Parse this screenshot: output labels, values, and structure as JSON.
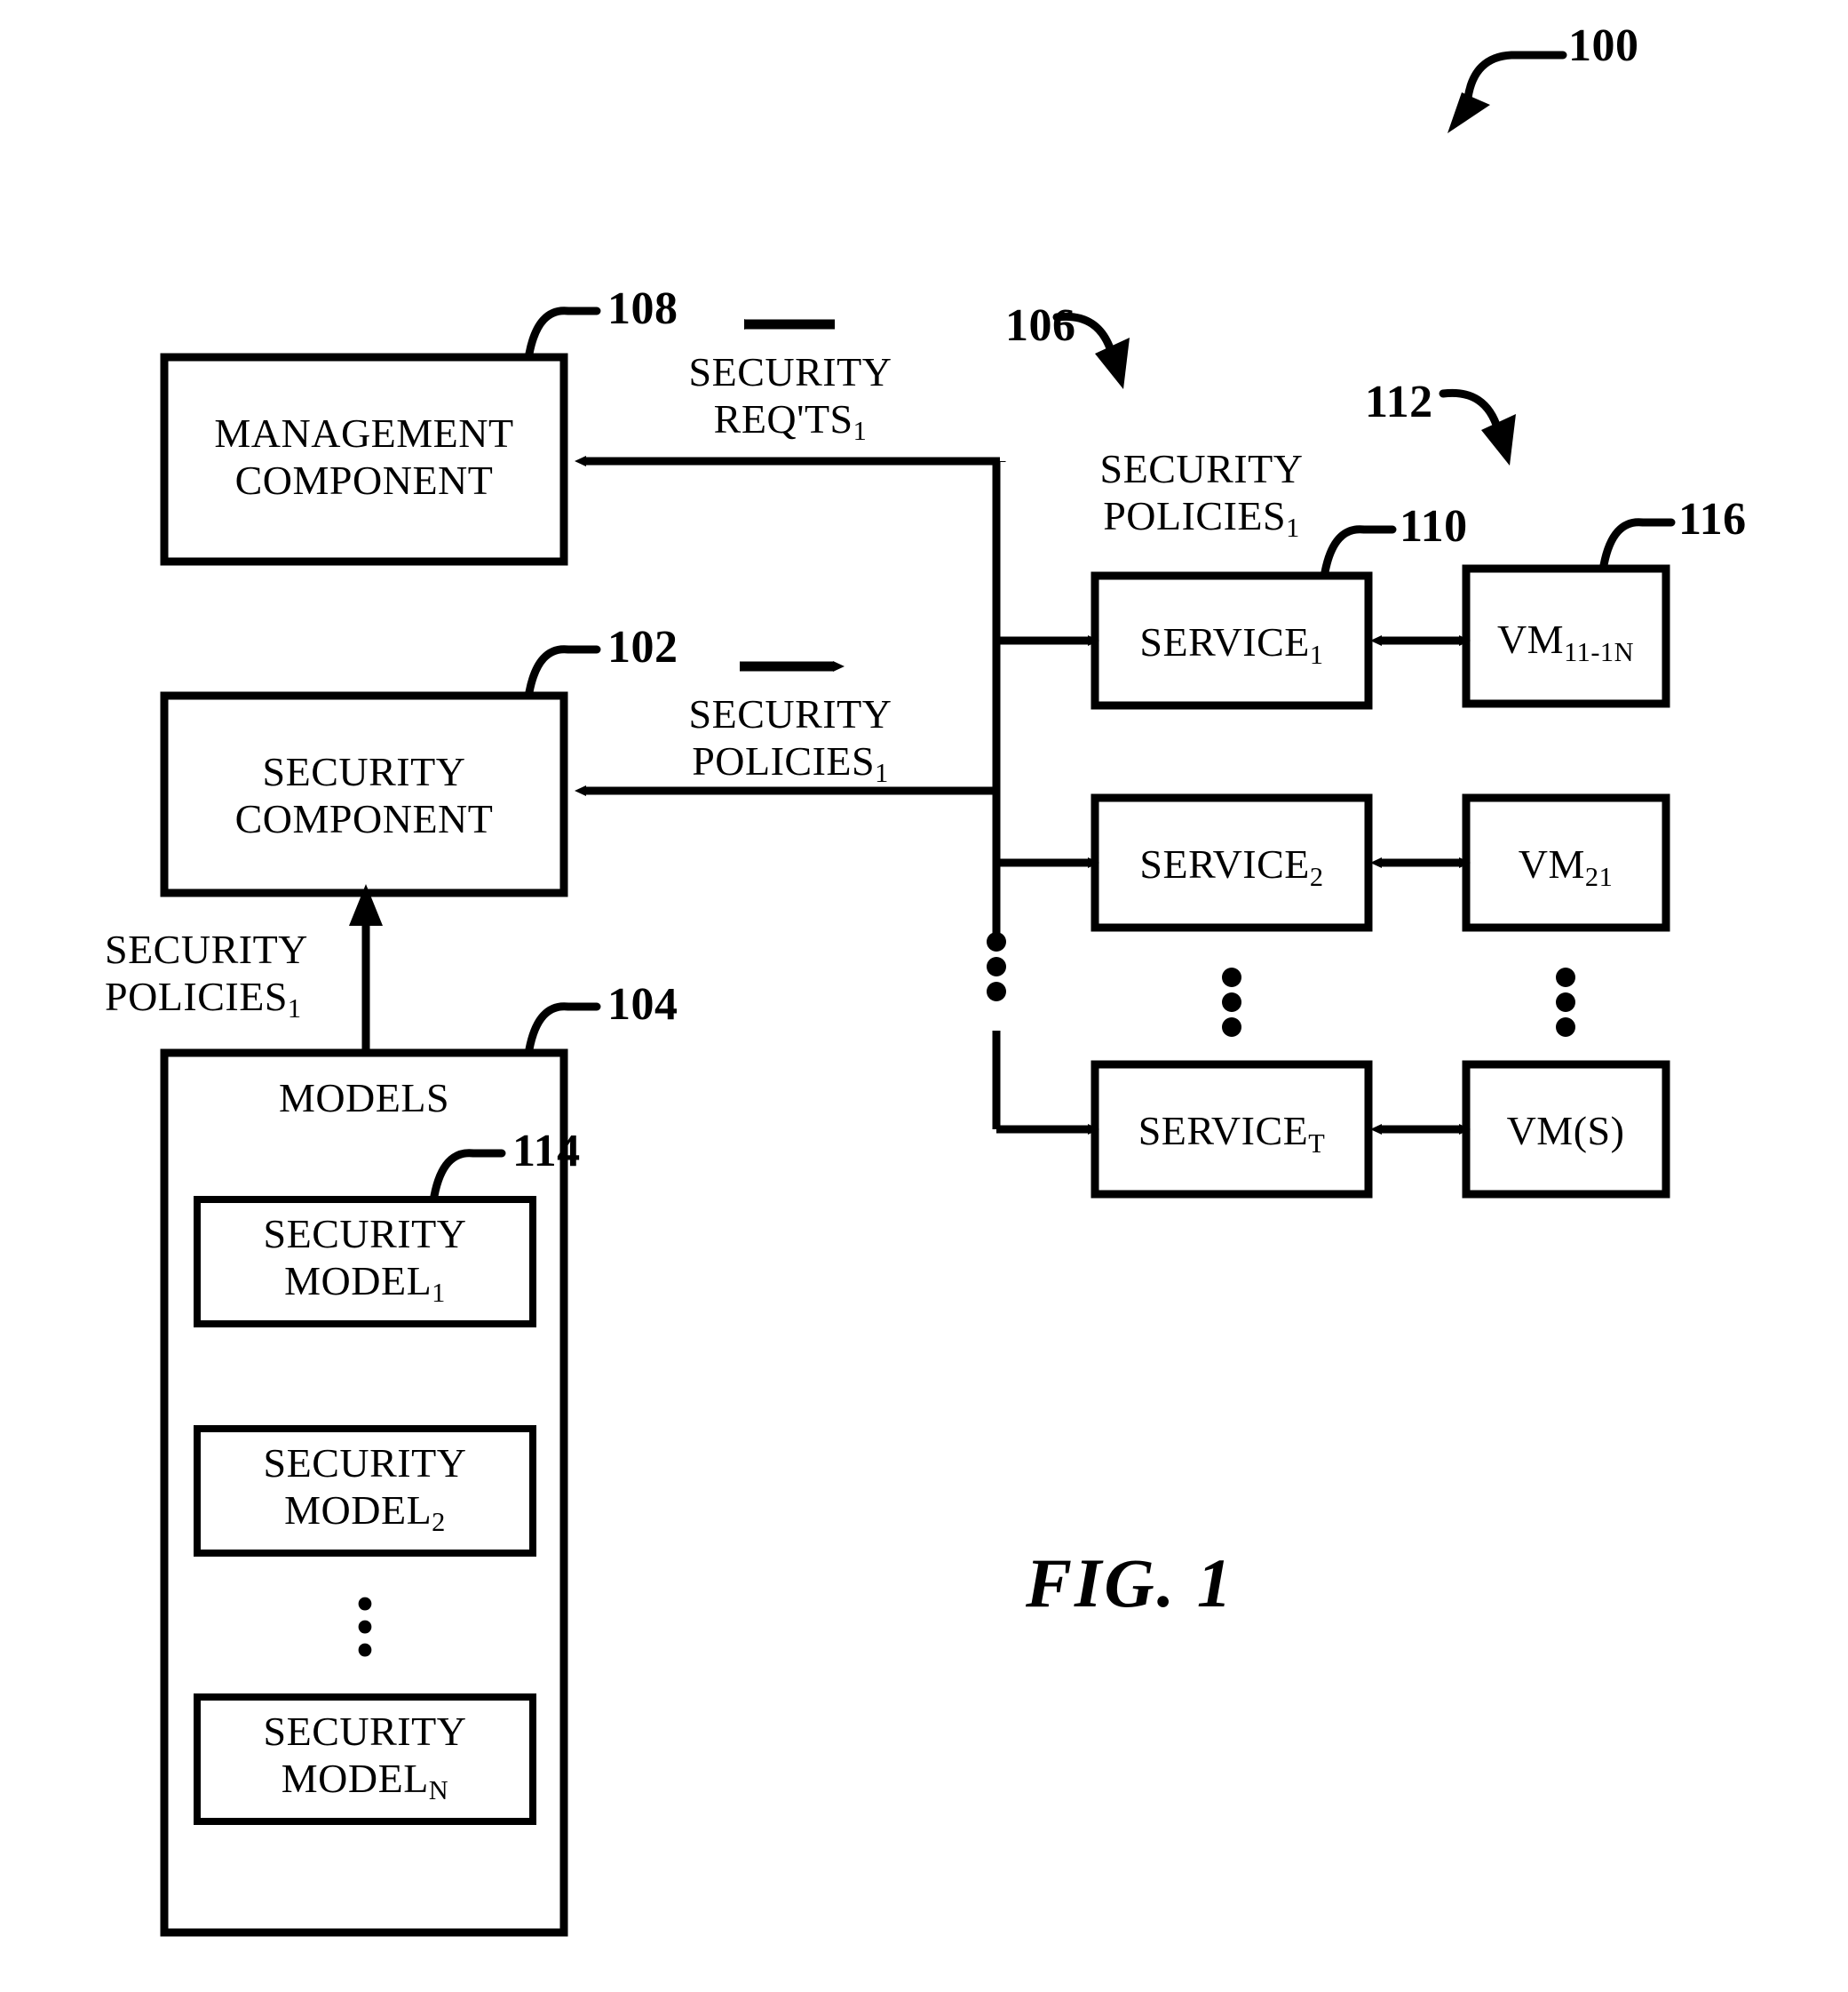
{
  "figure": {
    "caption": "FIG. 1",
    "system_ref": "100"
  },
  "boxes": {
    "management_component": {
      "line1": "MANAGEMENT",
      "line2": "COMPONENT",
      "ref": "108"
    },
    "security_component": {
      "line1": "SECURITY",
      "line2": "COMPONENT",
      "ref": "102"
    },
    "models": {
      "title": "MODELS",
      "ref": "104",
      "items": [
        {
          "line1": "SECURITY",
          "line2": "MODEL",
          "sub": "1",
          "ref": "114"
        },
        {
          "line1": "SECURITY",
          "line2": "MODEL",
          "sub": "2",
          "ref": ""
        },
        {
          "line1": "SECURITY",
          "line2": "MODEL",
          "sub": "N",
          "ref": ""
        }
      ],
      "ellipsis": "⋮"
    }
  },
  "services": {
    "group_ref": "106",
    "service_ref": "110",
    "vm_group_ref": "112",
    "vm_ref": "116",
    "policies_label_line1": "SECURITY",
    "policies_label_line2": "POLICIES",
    "policies_label_sub": "1",
    "rows": [
      {
        "service_name": "SERVICE",
        "service_sub": "1",
        "vm_name": "VM",
        "vm_sub": "11-1N"
      },
      {
        "service_name": "SERVICE",
        "service_sub": "2",
        "vm_name": "VM",
        "vm_sub": "21"
      },
      {
        "service_name": "SERVICE",
        "service_sub": "T",
        "vm_name": "VM(S)",
        "vm_sub": ""
      }
    ],
    "ellipsis": "⋮"
  },
  "flows": {
    "security_reqts": {
      "line1": "SECURITY",
      "line2": "REQ'TS",
      "sub": "1",
      "direction": "left"
    },
    "security_policies_to_services": {
      "line1": "SECURITY",
      "line2": "POLICIES",
      "sub": "1",
      "direction": "right"
    },
    "security_policies_from_models": {
      "line1": "SECURITY",
      "line2": "POLICIES",
      "sub": "1",
      "direction": "up"
    }
  },
  "colors": {
    "stroke": "#000000",
    "background": "#ffffff"
  }
}
